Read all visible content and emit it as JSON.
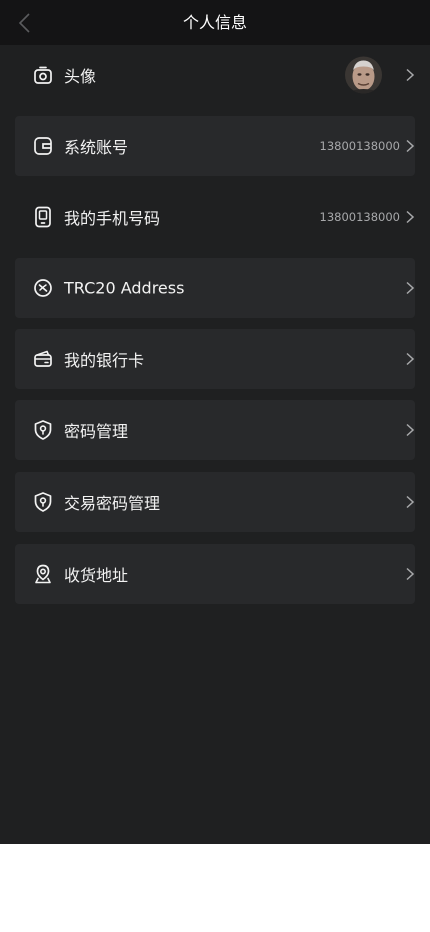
{
  "header": {
    "title": "个人信息"
  },
  "rows": [
    {
      "label": "头像",
      "icon": "camera-icon"
    },
    {
      "label": "系统账号",
      "value": "13800138000",
      "icon": "wallet-icon"
    },
    {
      "label": "我的手机号码",
      "value": "13800138000",
      "icon": "phone-icon"
    },
    {
      "label": "TRC20 Address",
      "icon": "compass-icon"
    },
    {
      "label": "我的银行卡",
      "icon": "card-icon"
    },
    {
      "label": "密码管理",
      "icon": "shield-lock-icon"
    },
    {
      "label": "交易密码管理",
      "icon": "shield-lock-icon"
    },
    {
      "label": "收货地址",
      "icon": "location-icon"
    }
  ],
  "colors": {
    "background": "#1f2021",
    "header_bg": "#141415",
    "row_shade": "#28292b",
    "text": "#f2f2f2",
    "muted": "#a7a8aa"
  }
}
